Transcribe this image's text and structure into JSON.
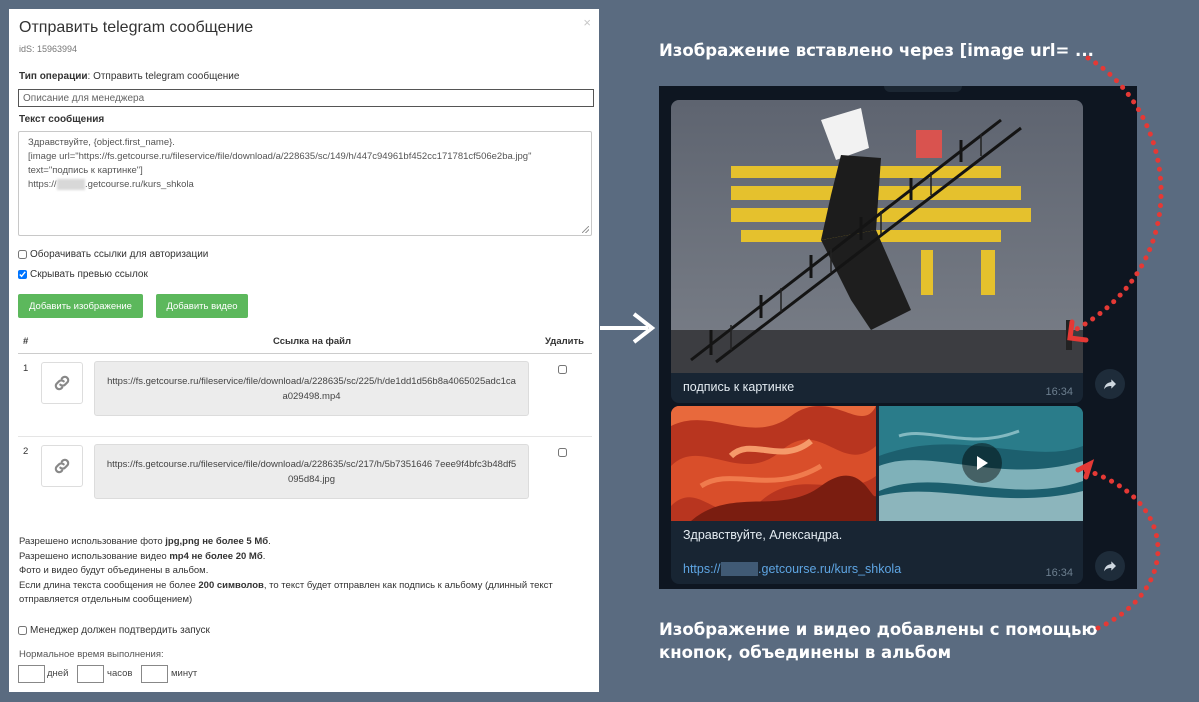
{
  "dialog": {
    "title": "Отправить telegram сообщение",
    "close": "×",
    "id_label": "idS: 15963994",
    "op_type_label": "Тип операции",
    "op_type_value": ": Отправить telegram сообщение",
    "description_placeholder": "Описание для менеджера",
    "message_label": "Текст сообщения",
    "message_line1": "Здравствуйте, {object.first_name}.",
    "message_line2": "[image url=\"https://fs.getcourse.ru/fileservice/file/download/a/228635/sc/149/h/447c94961bf452cc171781cf506e2ba.jpg\"",
    "message_line3": "text=\"подпись к картинке\"]",
    "message_line4_prefix": "https://",
    "message_line4_hidden": "xxxxxx",
    "message_line4_suffix": ".getcourse.ru/kurs_shkola",
    "wrap_links_label": "Оборачивать ссылки для авторизации",
    "wrap_links_checked": false,
    "hide_preview_label": "Скрывать превью ссылок",
    "hide_preview_checked": true,
    "add_image_button": "Добавить изображение",
    "add_video_button": "Добавить видео",
    "table": {
      "col_num": "#",
      "col_link": "Ссылка на файл",
      "col_delete": "Удалить",
      "rows": [
        {
          "num": "1",
          "url": "https://fs.getcourse.ru/fileservice/file/download/a/228635/sc/225/h/de1dd1d56b8a4065025adc1caa029498.mp4"
        },
        {
          "num": "2",
          "url": "https://fs.getcourse.ru/fileservice/file/download/a/228635/sc/217/h/5b7351646 7eee9f4bfc3b48df5095d84.jpg"
        }
      ]
    },
    "info": {
      "l1a": "Разрешено использование фото ",
      "l1b": "jpg,png не более 5 Мб",
      "l1c": ".",
      "l2a": "Разрешено использование видео ",
      "l2b": "mp4 не более 20 Мб",
      "l2c": ".",
      "l3": "Фото и видео будут объединены в альбом.",
      "l4a": "Если длина текста сообщения не более ",
      "l4b": "200 символов",
      "l4c": ", то текст будет отправлен как подпись к альбому (длинный текст",
      "l5": "отправляется отдельным сообщением)"
    },
    "manager_confirm_label": "Менеджер должен подтвердить запуск",
    "manager_confirm_checked": false,
    "normal_time_label": "Нормальное время выполнения:",
    "days_label": "дней",
    "hours_label": "часов",
    "minutes_label": "минут"
  },
  "annotations": {
    "top": "Изображение вставлено через [image url= ...",
    "bottom_line1": "Изображение и видео добавлены с помощью",
    "bottom_line2": "кнопок, объединены в альбом"
  },
  "telegram": {
    "caption1": "подпись к картинке",
    "time1": "16:34",
    "greeting": "Здравствуйте, Александра.",
    "link_prefix": "https://",
    "link_hidden": "xxxxxx",
    "link_suffix": ".getcourse.ru/kurs_shkola",
    "time2": "16:34"
  },
  "colors": {
    "background": "#5a6b80",
    "green_button": "#5cb85c",
    "telegram_bg": "#0e1621",
    "telegram_bubble": "#182533",
    "telegram_link": "#5ea5e3",
    "annotation_dots": "#e53935"
  },
  "icons": {
    "link": "link-icon",
    "play": "play-icon",
    "forward": "forward-icon",
    "arrow": "arrow-right-icon",
    "close": "close-icon"
  }
}
